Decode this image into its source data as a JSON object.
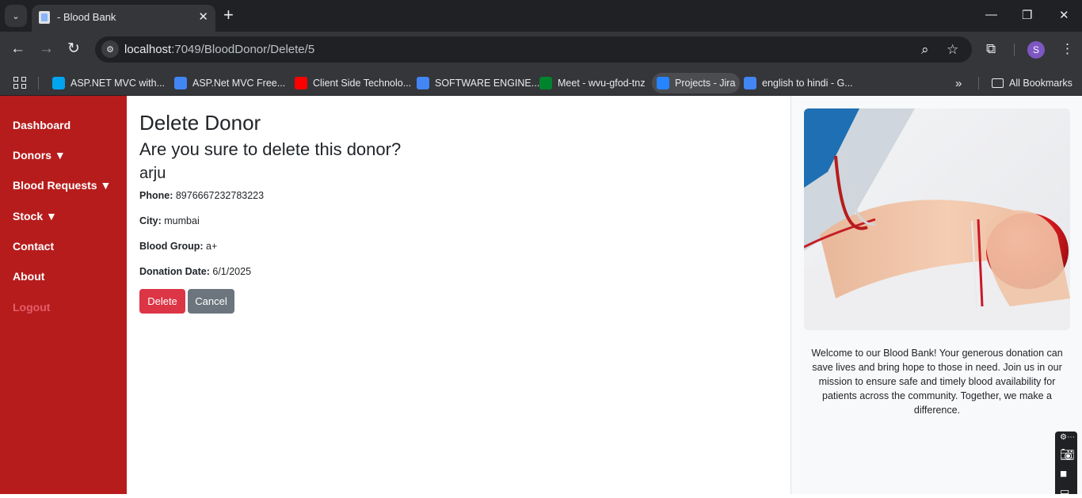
{
  "browser": {
    "tab_title": "- Blood Bank",
    "url_host": "localhost",
    "url_path": ":7049/BloodDonor/Delete/5",
    "profile_initial": "S",
    "bookmarks": [
      {
        "label": "ASP.NET MVC with...",
        "color": "#00a4ef"
      },
      {
        "label": "ASP.Net MVC Free...",
        "color": "#4285f4"
      },
      {
        "label": "Client Side Technolo...",
        "color": "#ff0000"
      },
      {
        "label": "SOFTWARE ENGINE...",
        "color": "#4285f4"
      },
      {
        "label": "Meet - wvu-gfod-tnz",
        "color": "#00832d"
      },
      {
        "label": "Projects - Jira",
        "color": "#2684ff"
      },
      {
        "label": "english to hindi - G...",
        "color": "#4285f4"
      }
    ],
    "all_bookmarks": "All Bookmarks"
  },
  "sidebar": {
    "items": [
      {
        "label": "Dashboard"
      },
      {
        "label": "Donors ▼"
      },
      {
        "label": "Blood Requests ▼"
      },
      {
        "label": "Stock ▼"
      },
      {
        "label": "Contact"
      },
      {
        "label": "About"
      },
      {
        "label": "Logout"
      }
    ]
  },
  "main": {
    "title": "Delete Donor",
    "question": "Are you sure to delete this donor?",
    "donor_name": "arju",
    "fields": [
      {
        "label": "Phone:",
        "value": "8976667232783223"
      },
      {
        "label": "City:",
        "value": "mumbai"
      },
      {
        "label": "Blood Group:",
        "value": "a+"
      },
      {
        "label": "Donation Date:",
        "value": "6/1/2025"
      }
    ],
    "delete_label": "Delete",
    "cancel_label": "Cancel"
  },
  "aside": {
    "welcome": "Welcome to our Blood Bank! Your generous donation can save lives and bring hope to those in need. Join us in our mission to ensure safe and timely blood availability for patients across the community. Together, we make a difference."
  },
  "colors": {
    "sidebar": "#b71c1c",
    "danger": "#dc3545",
    "secondary": "#6c757d",
    "logout": "#e35d6a"
  }
}
